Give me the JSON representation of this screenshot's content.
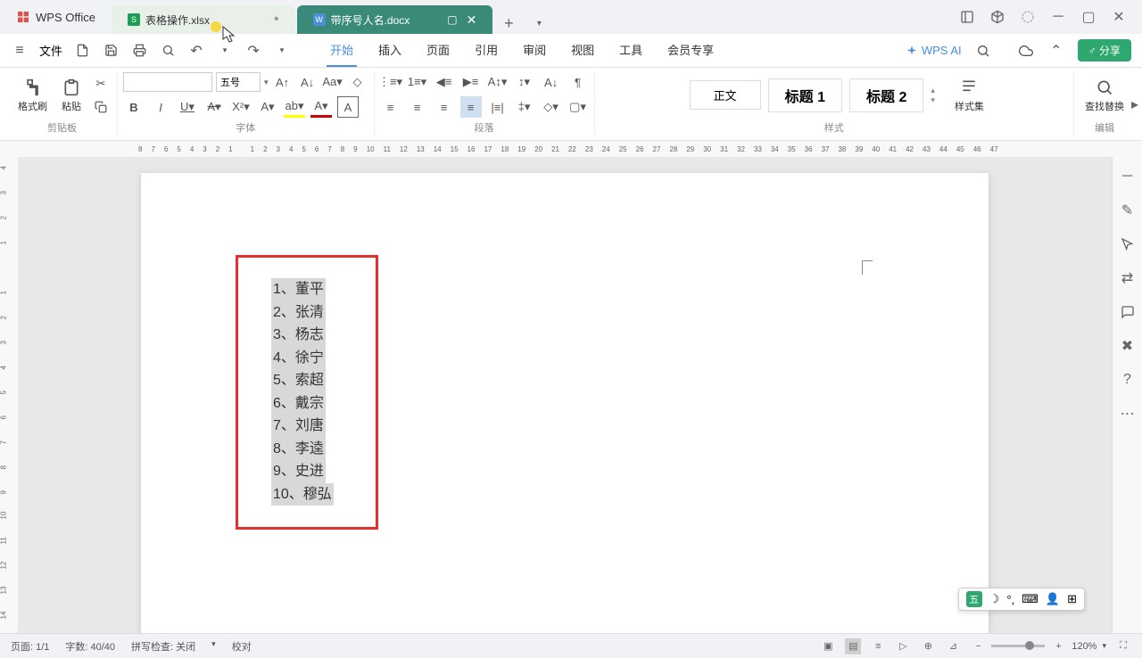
{
  "app": {
    "name": "WPS Office"
  },
  "tabs": {
    "xlsx": {
      "label": "表格操作.xlsx",
      "icon": "S"
    },
    "doc": {
      "label": "带序号人名.docx",
      "icon": "W"
    }
  },
  "menu": {
    "file": "文件",
    "tabs": [
      "开始",
      "插入",
      "页面",
      "引用",
      "审阅",
      "视图",
      "工具",
      "会员专享"
    ],
    "active_index": 0,
    "wps_ai": "WPS AI",
    "share": "分享"
  },
  "ribbon": {
    "clipboard": {
      "format_painter": "格式刷",
      "paste": "粘贴",
      "label": "剪贴板"
    },
    "font": {
      "name_placeholder": "",
      "size": "五号",
      "label": "字体"
    },
    "paragraph": {
      "label": "段落"
    },
    "styles": {
      "normal": "正文",
      "heading1": "标题 1",
      "heading2": "标题 2",
      "styleset": "样式集",
      "label": "样式"
    },
    "editing": {
      "find_replace": "查找替换",
      "label": "编辑"
    }
  },
  "ruler_h": [
    "8",
    "7",
    "6",
    "5",
    "4",
    "3",
    "2",
    "1",
    "",
    "1",
    "2",
    "3",
    "4",
    "5",
    "6",
    "7",
    "8",
    "9",
    "10",
    "11",
    "12",
    "13",
    "14",
    "15",
    "16",
    "17",
    "18",
    "19",
    "20",
    "21",
    "22",
    "23",
    "24",
    "25",
    "26",
    "27",
    "28",
    "29",
    "30",
    "31",
    "32",
    "33",
    "34",
    "35",
    "36",
    "37",
    "38",
    "39",
    "40",
    "41",
    "42",
    "43",
    "44",
    "45",
    "46",
    "47"
  ],
  "ruler_v": [
    "4",
    "3",
    "2",
    "1",
    "",
    "1",
    "2",
    "3",
    "4",
    "5",
    "6",
    "7",
    "8",
    "9",
    "10",
    "11",
    "12",
    "13",
    "14"
  ],
  "document": {
    "lines": [
      "1、董平",
      "2、张清",
      "3、杨志",
      "4、徐宁",
      "5、索超",
      "6、戴宗",
      "7、刘唐",
      "8、李逵",
      "9、史进",
      "10、穆弘"
    ]
  },
  "statusbar": {
    "page": "页面: 1/1",
    "words": "字数: 40/40",
    "spell": "拼写检查: 关闭",
    "proof": "校对",
    "zoom": "120%"
  },
  "ime": {
    "label": "五"
  }
}
